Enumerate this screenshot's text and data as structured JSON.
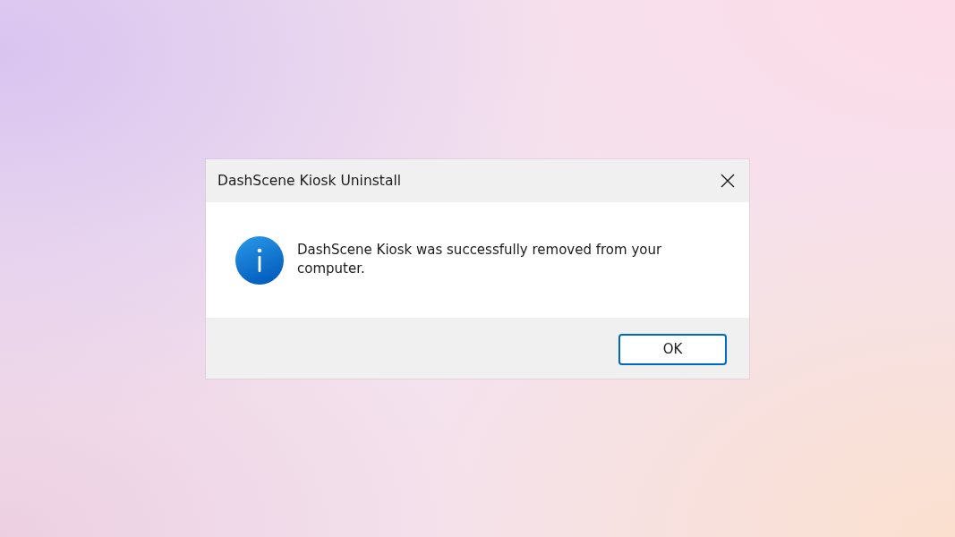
{
  "window": {
    "title": "DashScene Kiosk Uninstall"
  },
  "message": "DashScene Kiosk was successfully removed from your computer.",
  "buttons": [
    {
      "label": "OK",
      "default": true
    }
  ]
}
